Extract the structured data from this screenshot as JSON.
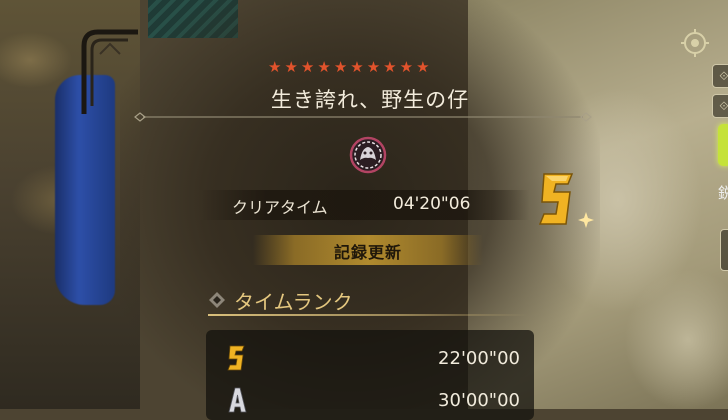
{
  "quest": {
    "star_count": 10,
    "title": "生き誇れ、野生の仔"
  },
  "result": {
    "clear_time_label": "クリアタイム",
    "clear_time_value": "04'20\"06",
    "achieved_rank": "S",
    "record_label": "記録更新"
  },
  "time_rank": {
    "section_title": "タイムランク",
    "ranks": [
      {
        "rank": "S",
        "time": "22'00\"00"
      },
      {
        "rank": "A",
        "time": "30'00\"00"
      }
    ]
  },
  "hud": {
    "side_char": "鋭"
  },
  "colors": {
    "star": "#e2532c",
    "gold": "#e4c77f",
    "rank_s": "#f0b323",
    "record_bar": "#b08a2e"
  }
}
